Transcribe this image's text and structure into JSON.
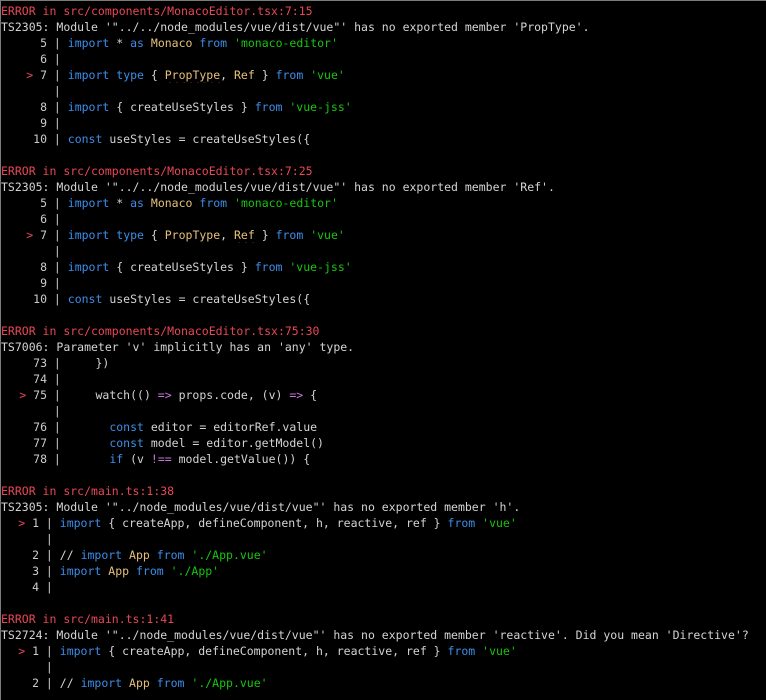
{
  "errors": [
    {
      "header_prefix": "ERROR in ",
      "location": "src/components/MonacoEditor.tsx:7:15",
      "code": "TS2305",
      "message": ": Module '\"../../node_modules/vue/dist/vue\"' has no exported member 'PropType'.",
      "lines": [
        {
          "num": "5",
          "marker": "",
          "code": "import * as Monaco from 'monaco-editor'"
        },
        {
          "num": "6",
          "marker": "",
          "code": ""
        },
        {
          "num": "7",
          "marker": ">",
          "code": "import type { PropType, Ref } from 'vue'"
        },
        {
          "num": "8",
          "marker": "",
          "code": "import { createUseStyles } from 'vue-jss'"
        },
        {
          "num": "9",
          "marker": "",
          "code": ""
        },
        {
          "num": "10",
          "marker": "",
          "code": "const useStyles = createUseStyles({"
        }
      ]
    },
    {
      "header_prefix": "ERROR in ",
      "location": "src/components/MonacoEditor.tsx:7:25",
      "code": "TS2305",
      "message": ": Module '\"../../node_modules/vue/dist/vue\"' has no exported member 'Ref'.",
      "lines": [
        {
          "num": "5",
          "marker": "",
          "code": "import * as Monaco from 'monaco-editor'"
        },
        {
          "num": "6",
          "marker": "",
          "code": ""
        },
        {
          "num": "7",
          "marker": ">",
          "code": "import type { PropType, Ref } from 'vue'"
        },
        {
          "num": "8",
          "marker": "",
          "code": "import { createUseStyles } from 'vue-jss'"
        },
        {
          "num": "9",
          "marker": "",
          "code": ""
        },
        {
          "num": "10",
          "marker": "",
          "code": "const useStyles = createUseStyles({"
        }
      ]
    },
    {
      "header_prefix": "ERROR in ",
      "location": "src/components/MonacoEditor.tsx:75:30",
      "code": "TS7006",
      "message": ": Parameter 'v' implicitly has an 'any' type.",
      "lines": [
        {
          "num": "73",
          "marker": "",
          "code": "    })"
        },
        {
          "num": "74",
          "marker": "",
          "code": ""
        },
        {
          "num": "75",
          "marker": ">",
          "code": "    watch(() => props.code, (v) => {"
        },
        {
          "num": "76",
          "marker": "",
          "code": "      const editor = editorRef.value"
        },
        {
          "num": "77",
          "marker": "",
          "code": "      const model = editor.getModel()"
        },
        {
          "num": "78",
          "marker": "",
          "code": "      if (v !== model.getValue()) {"
        }
      ]
    },
    {
      "header_prefix": "ERROR in ",
      "location": "src/main.ts:1:38",
      "code": "TS2305",
      "message": ": Module '\"../node_modules/vue/dist/vue\"' has no exported member 'h'.",
      "lines": [
        {
          "num": "1",
          "marker": ">",
          "code": "import { createApp, defineComponent, h, reactive, ref } from 'vue'"
        },
        {
          "num": "2",
          "marker": "",
          "code": "// import App from './App.vue'"
        },
        {
          "num": "3",
          "marker": "",
          "code": "import App from './App'"
        },
        {
          "num": "4",
          "marker": "",
          "code": ""
        }
      ]
    },
    {
      "header_prefix": "ERROR in ",
      "location": "src/main.ts:1:41",
      "code": "TS2724",
      "message": ": Module '\"../node_modules/vue/dist/vue\"' has no exported member 'reactive'. Did you mean 'Directive'?",
      "lines": [
        {
          "num": "1",
          "marker": ">",
          "code": "import { createApp, defineComponent, h, reactive, ref } from 'vue'"
        },
        {
          "num": "2",
          "marker": "",
          "code": "// import App from './App.vue'"
        }
      ]
    }
  ],
  "colors": {
    "error": "#e74856",
    "keyword": "#3b8eea",
    "string": "#16c60c",
    "type": "#e5c07b",
    "background": "#000000"
  }
}
